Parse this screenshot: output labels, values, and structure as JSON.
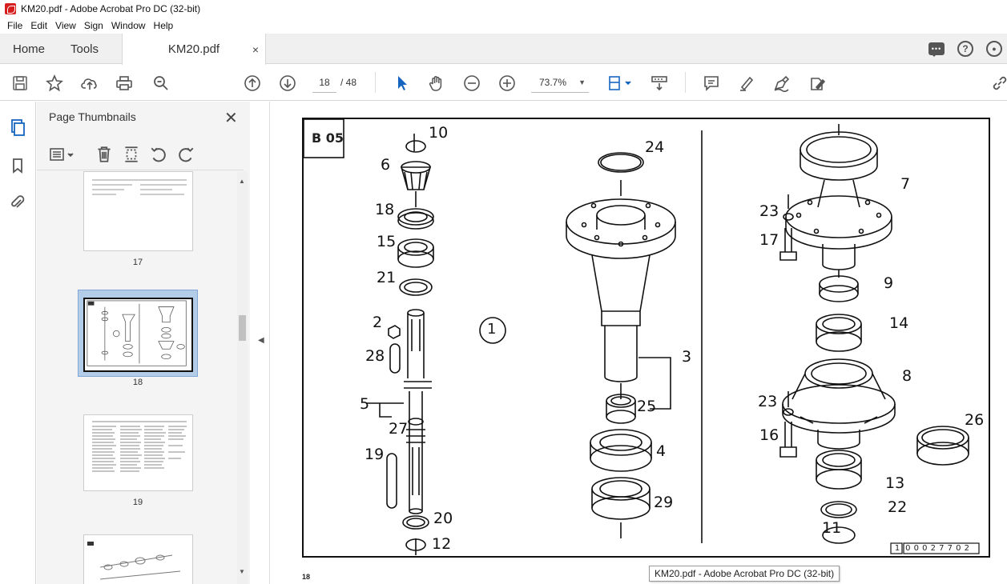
{
  "window": {
    "title": "KM20.pdf - Adobe Acrobat Pro DC (32-bit)"
  },
  "menu": [
    "File",
    "Edit",
    "View",
    "Sign",
    "Window",
    "Help"
  ],
  "tabs": {
    "home": "Home",
    "tools": "Tools",
    "document": "KM20.pdf",
    "close": "×"
  },
  "toolbar": {
    "current_page": "18",
    "total_pages": "/ 48",
    "zoom": "73.7%"
  },
  "panel": {
    "title": "Page Thumbnails",
    "close": "✕",
    "thumbnails": [
      {
        "label": "17",
        "selected": false
      },
      {
        "label": "18",
        "selected": true
      },
      {
        "label": "19",
        "selected": false
      },
      {
        "label": "",
        "selected": false
      }
    ]
  },
  "page": {
    "section_code": "B 05",
    "group_callout": "1",
    "part_numbers": [
      "10",
      "6",
      "18",
      "15",
      "21",
      "2",
      "28",
      "5",
      "27",
      "19",
      "20",
      "12",
      "24",
      "3",
      "25",
      "4",
      "29",
      "7",
      "23",
      "17",
      "9",
      "14",
      "8",
      "23",
      "16",
      "26",
      "13",
      "22",
      "11"
    ],
    "drawing_number": [
      "1",
      "0",
      "0",
      "0",
      "2",
      "7",
      "7",
      "0",
      "2"
    ],
    "footer_page_number": "18"
  },
  "tooltip": "KM20.pdf - Adobe Acrobat Pro DC (32-bit)"
}
